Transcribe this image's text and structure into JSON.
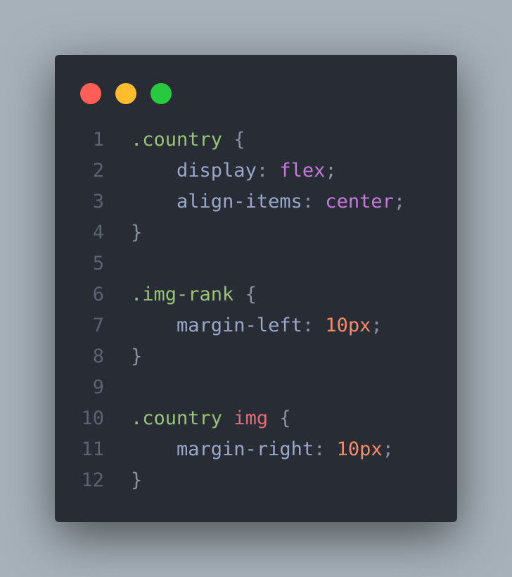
{
  "window": {
    "controls": [
      {
        "name": "close",
        "color": "#ff5f56"
      },
      {
        "name": "minimize",
        "color": "#ffbd2e"
      },
      {
        "name": "zoom",
        "color": "#27c93f"
      }
    ]
  },
  "code": {
    "lines": [
      {
        "n": "1",
        "tokens": [
          {
            "t": ".country",
            "k": "selector"
          },
          {
            "t": " ",
            "k": "space"
          },
          {
            "t": "{",
            "k": "brace"
          }
        ]
      },
      {
        "n": "2",
        "tokens": [
          {
            "t": "    ",
            "k": "space"
          },
          {
            "t": "display",
            "k": "prop"
          },
          {
            "t": ": ",
            "k": "punct"
          },
          {
            "t": "flex",
            "k": "keyword"
          },
          {
            "t": ";",
            "k": "punct"
          }
        ]
      },
      {
        "n": "3",
        "tokens": [
          {
            "t": "    ",
            "k": "space"
          },
          {
            "t": "align-items",
            "k": "prop"
          },
          {
            "t": ": ",
            "k": "punct"
          },
          {
            "t": "center",
            "k": "keyword"
          },
          {
            "t": ";",
            "k": "punct"
          }
        ]
      },
      {
        "n": "4",
        "tokens": [
          {
            "t": "}",
            "k": "brace"
          }
        ]
      },
      {
        "n": "5",
        "tokens": []
      },
      {
        "n": "6",
        "tokens": [
          {
            "t": ".img-rank",
            "k": "selector"
          },
          {
            "t": " ",
            "k": "space"
          },
          {
            "t": "{",
            "k": "brace"
          }
        ]
      },
      {
        "n": "7",
        "tokens": [
          {
            "t": "    ",
            "k": "space"
          },
          {
            "t": "margin-left",
            "k": "prop"
          },
          {
            "t": ": ",
            "k": "punct"
          },
          {
            "t": "10px",
            "k": "number"
          },
          {
            "t": ";",
            "k": "punct"
          }
        ]
      },
      {
        "n": "8",
        "tokens": [
          {
            "t": "}",
            "k": "brace"
          }
        ]
      },
      {
        "n": "9",
        "tokens": []
      },
      {
        "n": "10",
        "tokens": [
          {
            "t": ".country",
            "k": "selector"
          },
          {
            "t": " ",
            "k": "space"
          },
          {
            "t": "img",
            "k": "tag"
          },
          {
            "t": " ",
            "k": "space"
          },
          {
            "t": "{",
            "k": "brace"
          }
        ]
      },
      {
        "n": "11",
        "tokens": [
          {
            "t": "    ",
            "k": "space"
          },
          {
            "t": "margin-right",
            "k": "prop"
          },
          {
            "t": ": ",
            "k": "punct"
          },
          {
            "t": "10px",
            "k": "number"
          },
          {
            "t": ";",
            "k": "punct"
          }
        ]
      },
      {
        "n": "12",
        "tokens": [
          {
            "t": "}",
            "k": "brace"
          }
        ]
      }
    ]
  }
}
